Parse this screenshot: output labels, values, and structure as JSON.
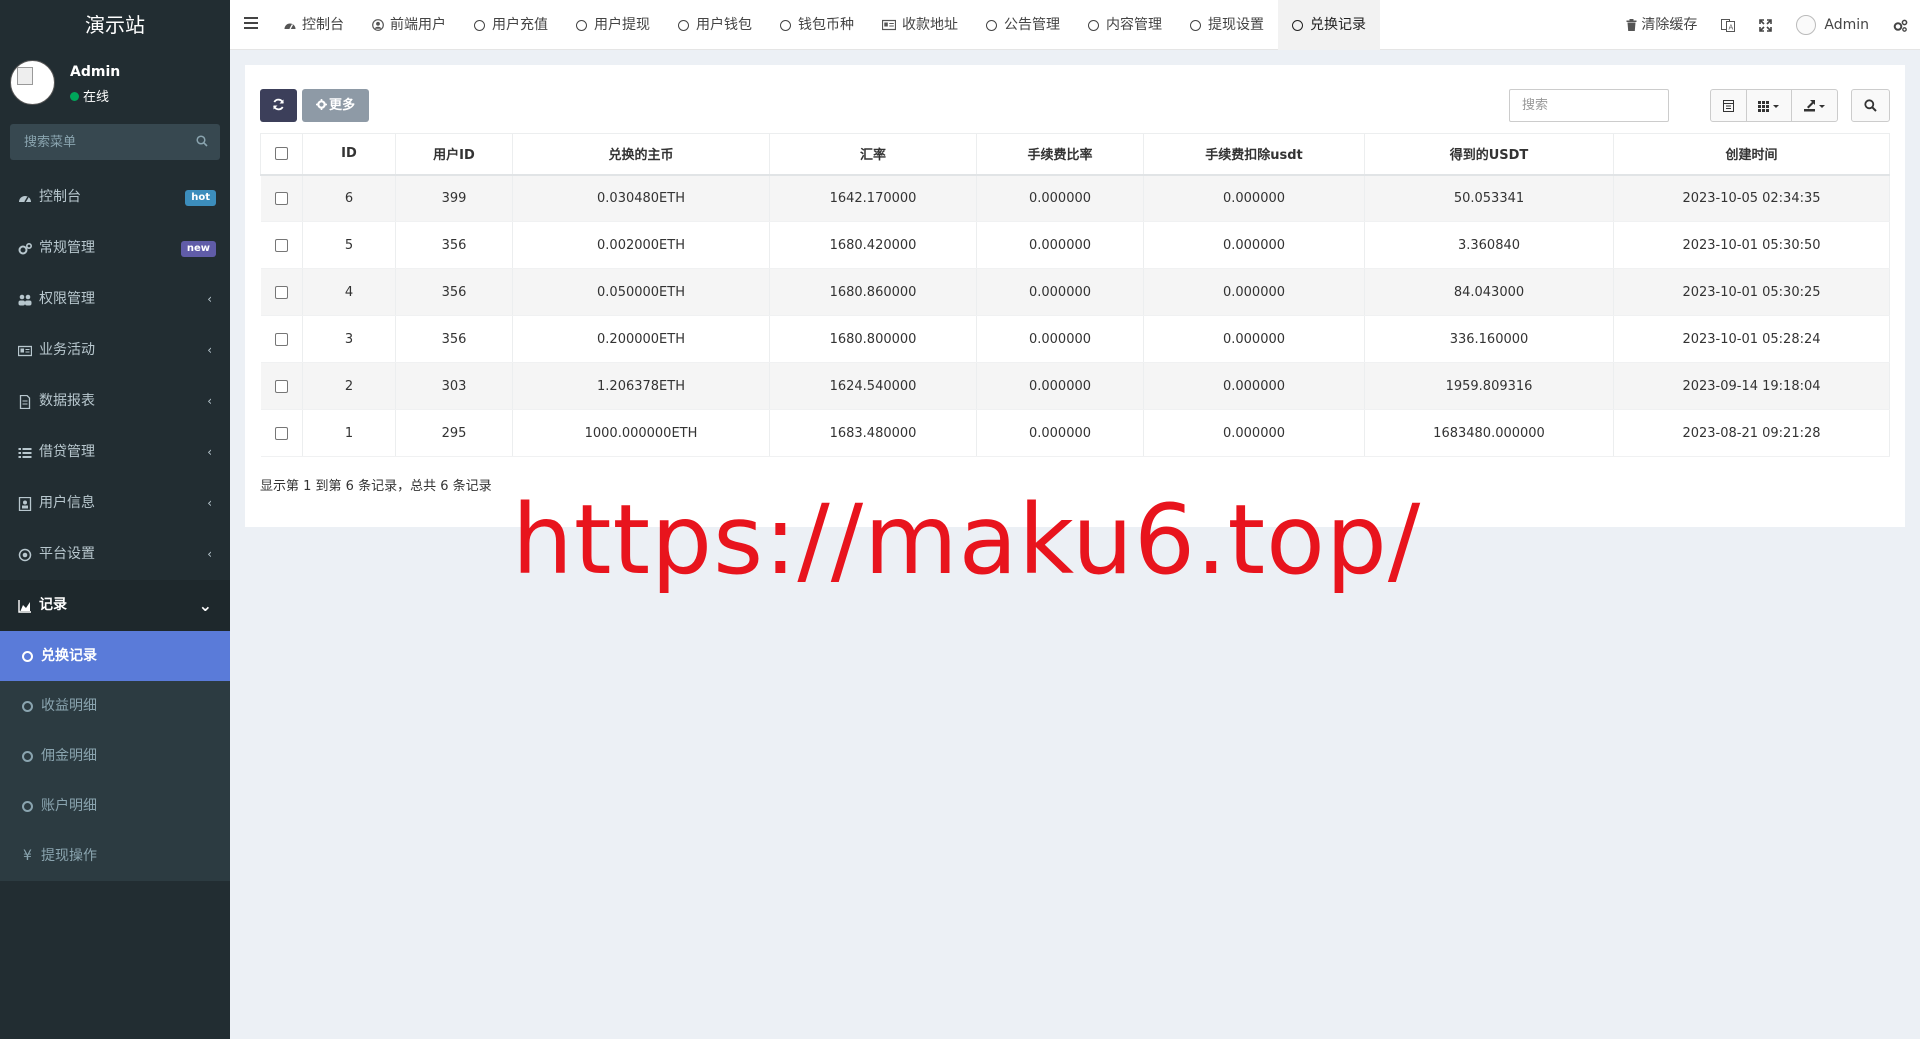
{
  "brand": {
    "title": "演示站"
  },
  "user": {
    "name": "Admin",
    "status": "在线"
  },
  "sidebar": {
    "search_placeholder": "搜索菜单",
    "items": [
      {
        "label": "控制台",
        "badge": "hot"
      },
      {
        "label": "常规管理",
        "badge": "new"
      },
      {
        "label": "权限管理",
        "chevron": "‹"
      },
      {
        "label": "业务活动",
        "chevron": "‹"
      },
      {
        "label": "数据报表",
        "chevron": "‹"
      },
      {
        "label": "借贷管理",
        "chevron": "‹"
      },
      {
        "label": "用户信息",
        "chevron": "‹"
      },
      {
        "label": "平台设置",
        "chevron": "‹"
      },
      {
        "label": "记录",
        "chevron": "⌄"
      }
    ],
    "submenu": [
      {
        "label": "兑换记录"
      },
      {
        "label": "收益明细"
      },
      {
        "label": "佣金明细"
      },
      {
        "label": "账户明细"
      },
      {
        "label": "提现操作",
        "icon": "¥"
      }
    ]
  },
  "topbar": {
    "tabs": [
      {
        "label": "控制台"
      },
      {
        "label": "前端用户"
      },
      {
        "label": "用户充值"
      },
      {
        "label": "用户提现"
      },
      {
        "label": "用户钱包"
      },
      {
        "label": "钱包币种"
      },
      {
        "label": "收款地址"
      },
      {
        "label": "公告管理"
      },
      {
        "label": "内容管理"
      },
      {
        "label": "提现设置"
      },
      {
        "label": "兑换记录"
      }
    ],
    "clear_cache": "清除缓存",
    "admin_name": "Admin"
  },
  "toolbar": {
    "more_label": "更多",
    "search_placeholder": "搜索"
  },
  "table": {
    "headers": [
      "ID",
      "用户ID",
      "兑换的主币",
      "汇率",
      "手续费比率",
      "手续费扣除usdt",
      "得到的USDT",
      "创建时间"
    ],
    "rows": [
      [
        "6",
        "399",
        "0.030480ETH",
        "1642.170000",
        "0.000000",
        "0.000000",
        "50.053341",
        "2023-10-05 02:34:35"
      ],
      [
        "5",
        "356",
        "0.002000ETH",
        "1680.420000",
        "0.000000",
        "0.000000",
        "3.360840",
        "2023-10-01 05:30:50"
      ],
      [
        "4",
        "356",
        "0.050000ETH",
        "1680.860000",
        "0.000000",
        "0.000000",
        "84.043000",
        "2023-10-01 05:30:25"
      ],
      [
        "3",
        "356",
        "0.200000ETH",
        "1680.800000",
        "0.000000",
        "0.000000",
        "336.160000",
        "2023-10-01 05:28:24"
      ],
      [
        "2",
        "303",
        "1.206378ETH",
        "1624.540000",
        "0.000000",
        "0.000000",
        "1959.809316",
        "2023-09-14 19:18:04"
      ],
      [
        "1",
        "295",
        "1000.000000ETH",
        "1683.480000",
        "0.000000",
        "0.000000",
        "1683480.000000",
        "2023-08-21 09:21:28"
      ]
    ]
  },
  "pager": {
    "info": "显示第 1 到第 6 条记录，总共 6 条记录"
  },
  "watermark": {
    "text": "https://maku6.top/",
    "color": "#e8141d"
  },
  "colors": {
    "sidebar_bg": "#222d32",
    "active_sub": "#5a7bd9",
    "hot": "#3c8dbc",
    "new": "#605ca8",
    "online": "#00a65a"
  }
}
